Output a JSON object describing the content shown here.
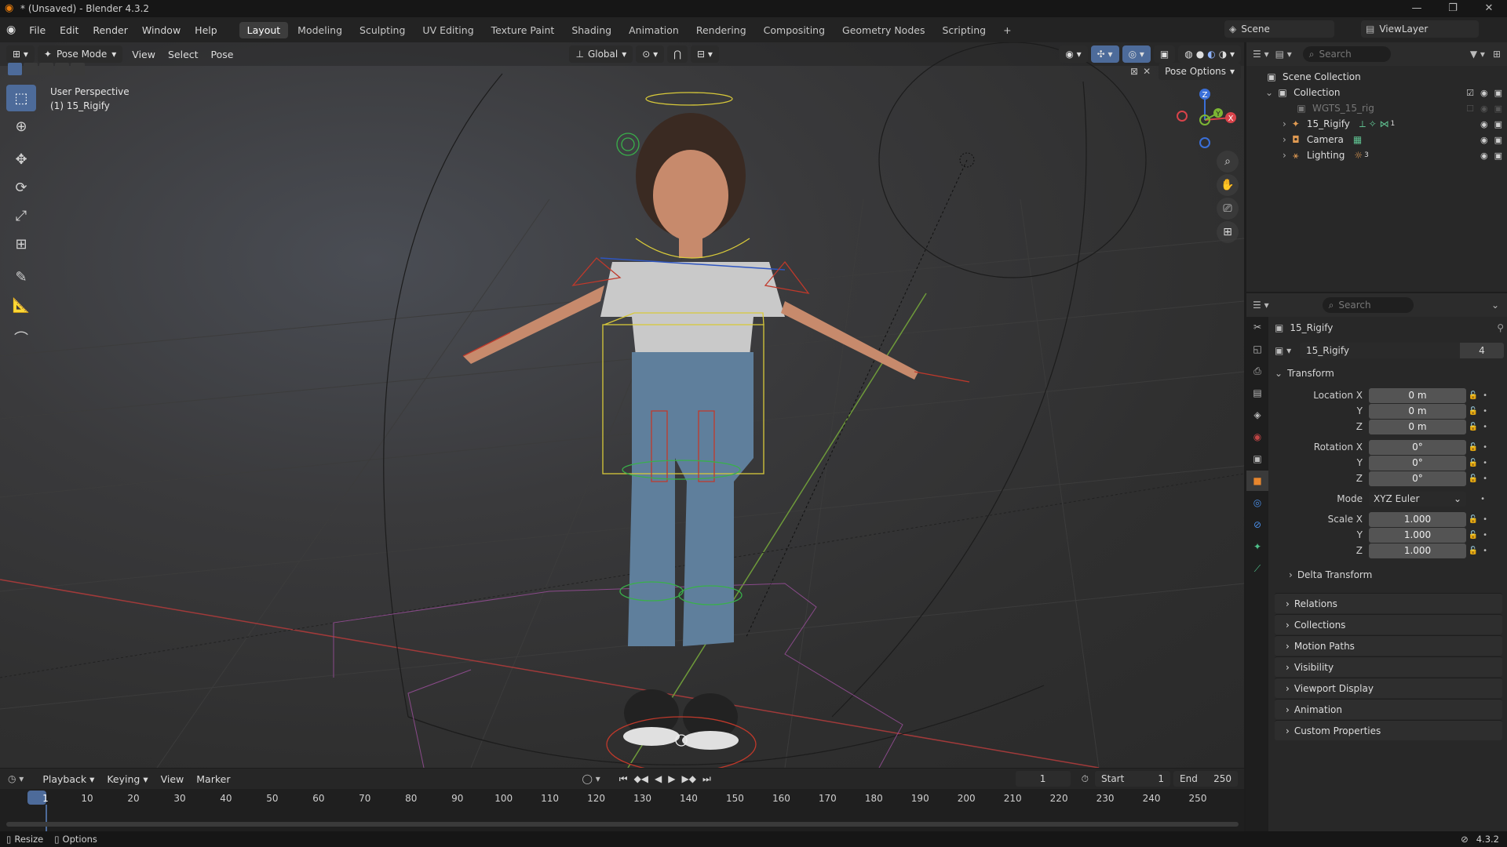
{
  "window": {
    "title": "* (Unsaved) - Blender 4.3.2",
    "controls": [
      "—",
      "❐",
      "✕"
    ]
  },
  "menu": {
    "items": [
      "File",
      "Edit",
      "Render",
      "Window",
      "Help"
    ]
  },
  "workspaces": {
    "tabs": [
      "Layout",
      "Modeling",
      "Sculpting",
      "UV Editing",
      "Texture Paint",
      "Shading",
      "Animation",
      "Rendering",
      "Compositing",
      "Geometry Nodes",
      "Scripting"
    ],
    "active": "Layout",
    "add": "+"
  },
  "scene": {
    "label": "Scene"
  },
  "viewlayer": {
    "label": "ViewLayer"
  },
  "viewport_header": {
    "mode": "Pose Mode",
    "menus": [
      "View",
      "Select",
      "Pose"
    ],
    "orientation": "Global",
    "pose_options": "Pose Options"
  },
  "viewport": {
    "perspective": "User Perspective",
    "object": "(1) 15_Rigify"
  },
  "gizmo": {
    "z": "Z",
    "y": "Y",
    "x": "X"
  },
  "outliner": {
    "search_placeholder": "Search",
    "scene_collection": "Scene Collection",
    "collection": "Collection",
    "items": [
      {
        "name": "WGTS_15_rig",
        "icon": "collection-icon",
        "dim": true
      },
      {
        "name": "15_Rigify",
        "icon": "armature-icon",
        "badge": "1"
      },
      {
        "name": "Camera",
        "icon": "camera-icon"
      },
      {
        "name": "Lighting",
        "icon": "light-icon",
        "badge": "3"
      }
    ]
  },
  "properties": {
    "search_placeholder": "Search",
    "object_name": "15_Rigify",
    "datablock": "15_Rigify",
    "users": "4",
    "transform_label": "Transform",
    "location": {
      "x_label": "Location X",
      "y_label": "Y",
      "z_label": "Z",
      "x": "0 m",
      "y": "0 m",
      "z": "0 m"
    },
    "rotation": {
      "x_label": "Rotation X",
      "y_label": "Y",
      "z_label": "Z",
      "x": "0°",
      "y": "0°",
      "z": "0°"
    },
    "mode": {
      "label": "Mode",
      "value": "XYZ Euler"
    },
    "scale": {
      "x_label": "Scale X",
      "y_label": "Y",
      "z_label": "Z",
      "x": "1.000",
      "y": "1.000",
      "z": "1.000"
    },
    "delta": "Delta Transform",
    "panels": [
      "Relations",
      "Collections",
      "Motion Paths",
      "Visibility",
      "Viewport Display",
      "Animation",
      "Custom Properties"
    ]
  },
  "timeline": {
    "menus": [
      "Playback",
      "Keying",
      "View",
      "Marker"
    ],
    "current_frame": "1",
    "start_label": "Start",
    "start": "1",
    "end_label": "End",
    "end": "250",
    "ticks": [
      "1",
      "10",
      "20",
      "30",
      "40",
      "50",
      "60",
      "70",
      "80",
      "90",
      "100",
      "110",
      "120",
      "130",
      "140",
      "150",
      "160",
      "170",
      "180",
      "190",
      "200",
      "210",
      "220",
      "230",
      "240",
      "250"
    ]
  },
  "statusbar": {
    "resize": "Resize",
    "options": "Options",
    "version": "4.3.2"
  }
}
